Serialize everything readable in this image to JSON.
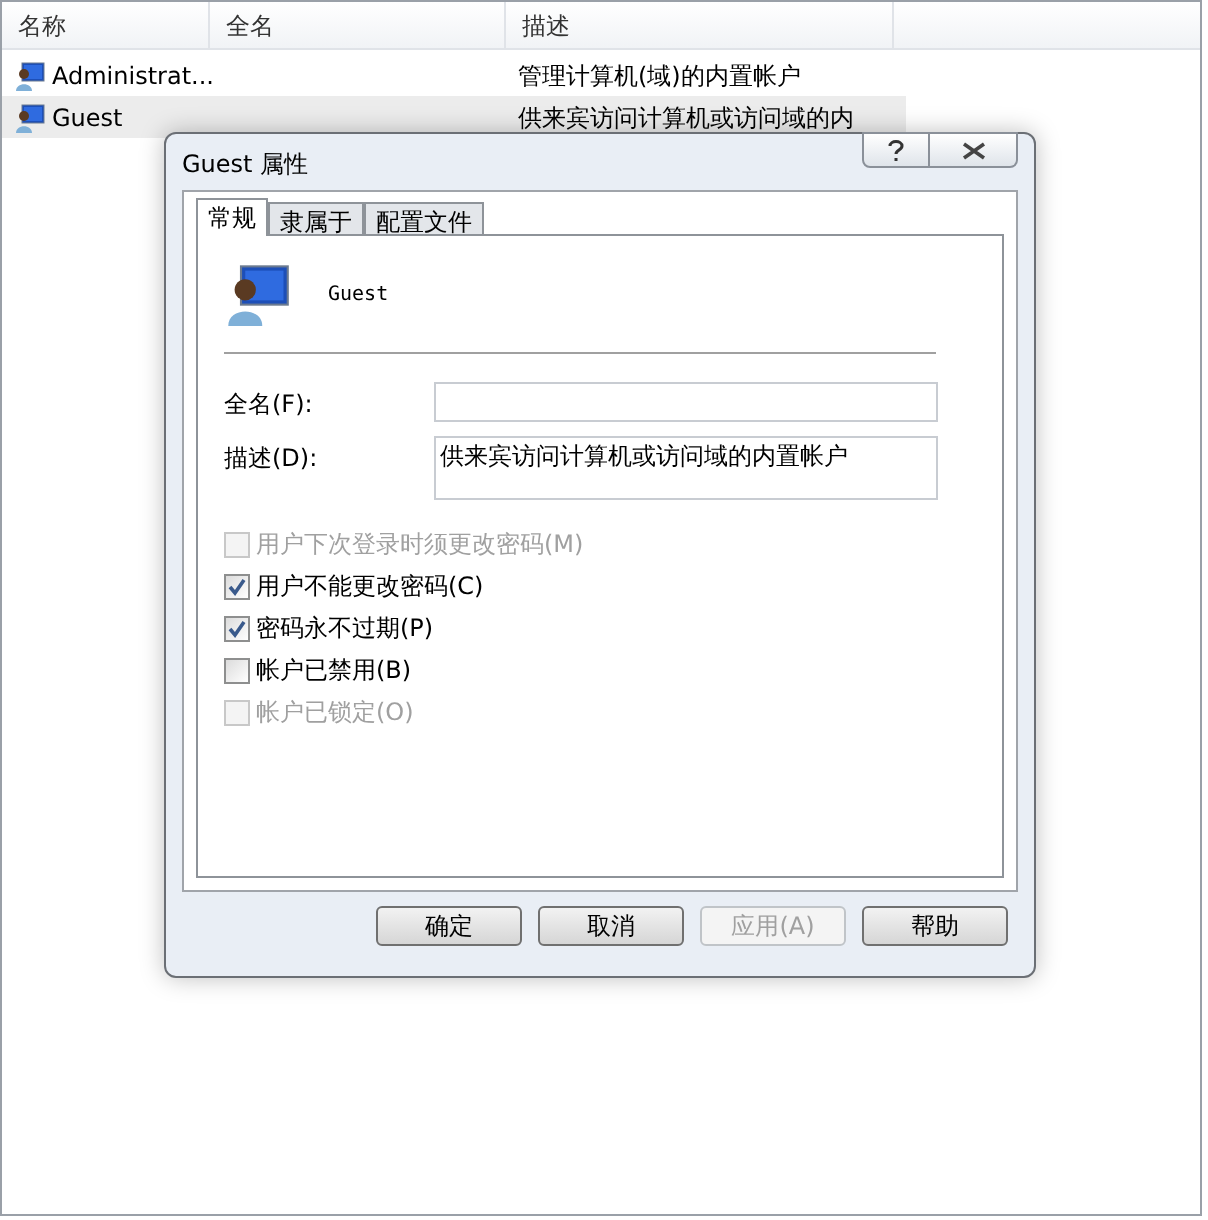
{
  "list": {
    "columns": [
      "名称",
      "全名",
      "描述"
    ],
    "rows": [
      {
        "name": "Administrat...",
        "description": "管理计算机(域)的内置帐户",
        "selected": false
      },
      {
        "name": "Guest",
        "description": "供来宾访问计算机或访问域的内",
        "selected": true
      }
    ]
  },
  "dialog": {
    "title": "Guest 属性",
    "tabs": [
      {
        "label": "常规",
        "selected": true
      },
      {
        "label": "隶属于",
        "selected": false
      },
      {
        "label": "配置文件",
        "selected": false
      }
    ],
    "user_name": "Guest",
    "fields": [
      {
        "label": "全名(F):"
      },
      {
        "label": "描述(D):",
        "value": "供来宾访问计算机或访问域的内置帐户"
      }
    ],
    "checkboxes": [
      {
        "label": "用户下次登录时须更改密码(M)",
        "checked": false,
        "disabled": true
      },
      {
        "label": "用户不能更改密码(C)",
        "checked": true,
        "disabled": false
      },
      {
        "label": "密码永不过期(P)",
        "checked": true,
        "disabled": false
      },
      {
        "label": "帐户已禁用(B)",
        "checked": false,
        "disabled": false
      },
      {
        "label": "帐户已锁定(O)",
        "checked": false,
        "disabled": true
      }
    ],
    "buttons": [
      {
        "label": "确定",
        "disabled": false
      },
      {
        "label": "取消",
        "disabled": false
      },
      {
        "label": "应用(A)",
        "disabled": true
      },
      {
        "label": "帮助",
        "disabled": false
      }
    ]
  }
}
